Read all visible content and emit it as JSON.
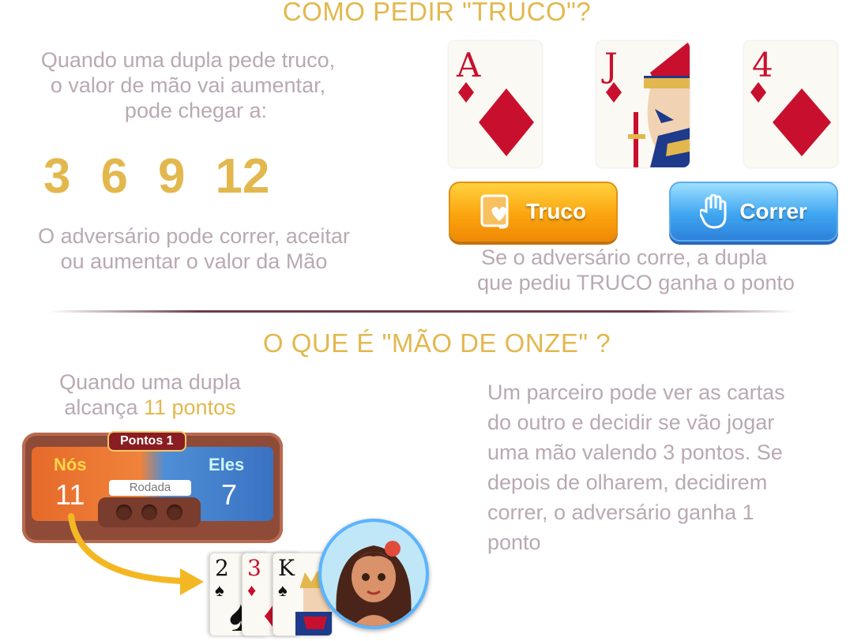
{
  "section1": {
    "title": "COMO PEDIR \"TRUCO\"?",
    "intro_lines": [
      "Quando uma dupla pede truco,",
      "o valor de mão vai aumentar,",
      "pode chegar a:"
    ],
    "values": [
      "3",
      "6",
      "9",
      "12"
    ],
    "outro_lines": [
      "O adversário pode correr, aceitar",
      "ou aumentar o valor da Mão"
    ],
    "cards": [
      {
        "rank": "A",
        "suit": "diamond"
      },
      {
        "rank": "J",
        "suit": "diamond"
      },
      {
        "rank": "4",
        "suit": "diamond"
      }
    ],
    "buttons": {
      "truco": "Truco",
      "correr": "Correr"
    },
    "caption_lines": [
      "Se o adversário corre, a dupla",
      "que pediu TRUCO ganha o ponto"
    ]
  },
  "section2": {
    "title": "O QUE É \"MÃO DE ONZE\" ?",
    "lead_line1": "Quando uma dupla",
    "lead_line2_prefix": "alcança ",
    "lead_line2_highlight": "11 pontos",
    "scoreboard": {
      "badge": "Pontos 1",
      "team_left": "Nós",
      "score_left": "11",
      "team_right": "Eles",
      "score_right": "7",
      "rodada": "Rodada"
    },
    "hand_cards": [
      {
        "rank": "2",
        "suit": "spade"
      },
      {
        "rank": "3",
        "suit": "diamond"
      },
      {
        "rank": "K",
        "suit": "spade"
      }
    ],
    "description": [
      "Um parceiro pode ver as cartas",
      "do outro e decidir se vão jogar",
      "uma mão valendo 3 pontos. Se",
      "depois de olharem, decidirem",
      "correr, o adversário ganha 1",
      "ponto"
    ]
  },
  "colors": {
    "gold": "#e2b84e",
    "muted_text": "#b9a9b3",
    "diamond_red": "#c8102e",
    "truco_orange": "#fba50f",
    "correr_blue": "#3fa6f1"
  }
}
